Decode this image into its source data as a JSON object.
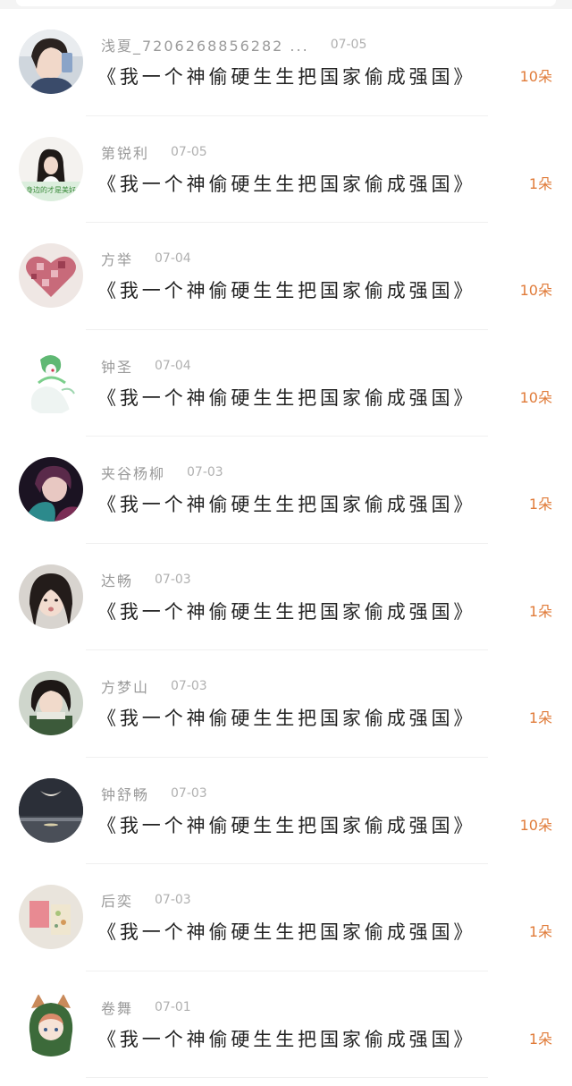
{
  "items": [
    {
      "name": "浅夏_7206268856282 ...",
      "date": "07-05",
      "title": "《我一个神偷硬生生把国家偷成强国》",
      "count": "10朵"
    },
    {
      "name": "第锐利",
      "date": "07-05",
      "title": "《我一个神偷硬生生把国家偷成强国》",
      "count": "1朵"
    },
    {
      "name": "方举",
      "date": "07-04",
      "title": "《我一个神偷硬生生把国家偷成强国》",
      "count": "10朵"
    },
    {
      "name": "钟圣",
      "date": "07-04",
      "title": "《我一个神偷硬生生把国家偷成强国》",
      "count": "10朵"
    },
    {
      "name": "夹谷杨柳",
      "date": "07-03",
      "title": "《我一个神偷硬生生把国家偷成强国》",
      "count": "1朵"
    },
    {
      "name": "达畅",
      "date": "07-03",
      "title": "《我一个神偷硬生生把国家偷成强国》",
      "count": "1朵"
    },
    {
      "name": "方梦山",
      "date": "07-03",
      "title": "《我一个神偷硬生生把国家偷成强国》",
      "count": "1朵"
    },
    {
      "name": "钟舒畅",
      "date": "07-03",
      "title": "《我一个神偷硬生生把国家偷成强国》",
      "count": "10朵"
    },
    {
      "name": "后奕",
      "date": "07-03",
      "title": "《我一个神偷硬生生把国家偷成强国》",
      "count": "1朵"
    },
    {
      "name": "卷舞",
      "date": "07-01",
      "title": "《我一个神偷硬生生把国家偷成强国》",
      "count": "1朵"
    }
  ],
  "avatar_overlay_text": "身边的才是美好",
  "colors": {
    "accent": "#e07b39",
    "meta_text": "#9a9a9a",
    "title_text": "#222222",
    "divider": "#f0f0f0"
  }
}
